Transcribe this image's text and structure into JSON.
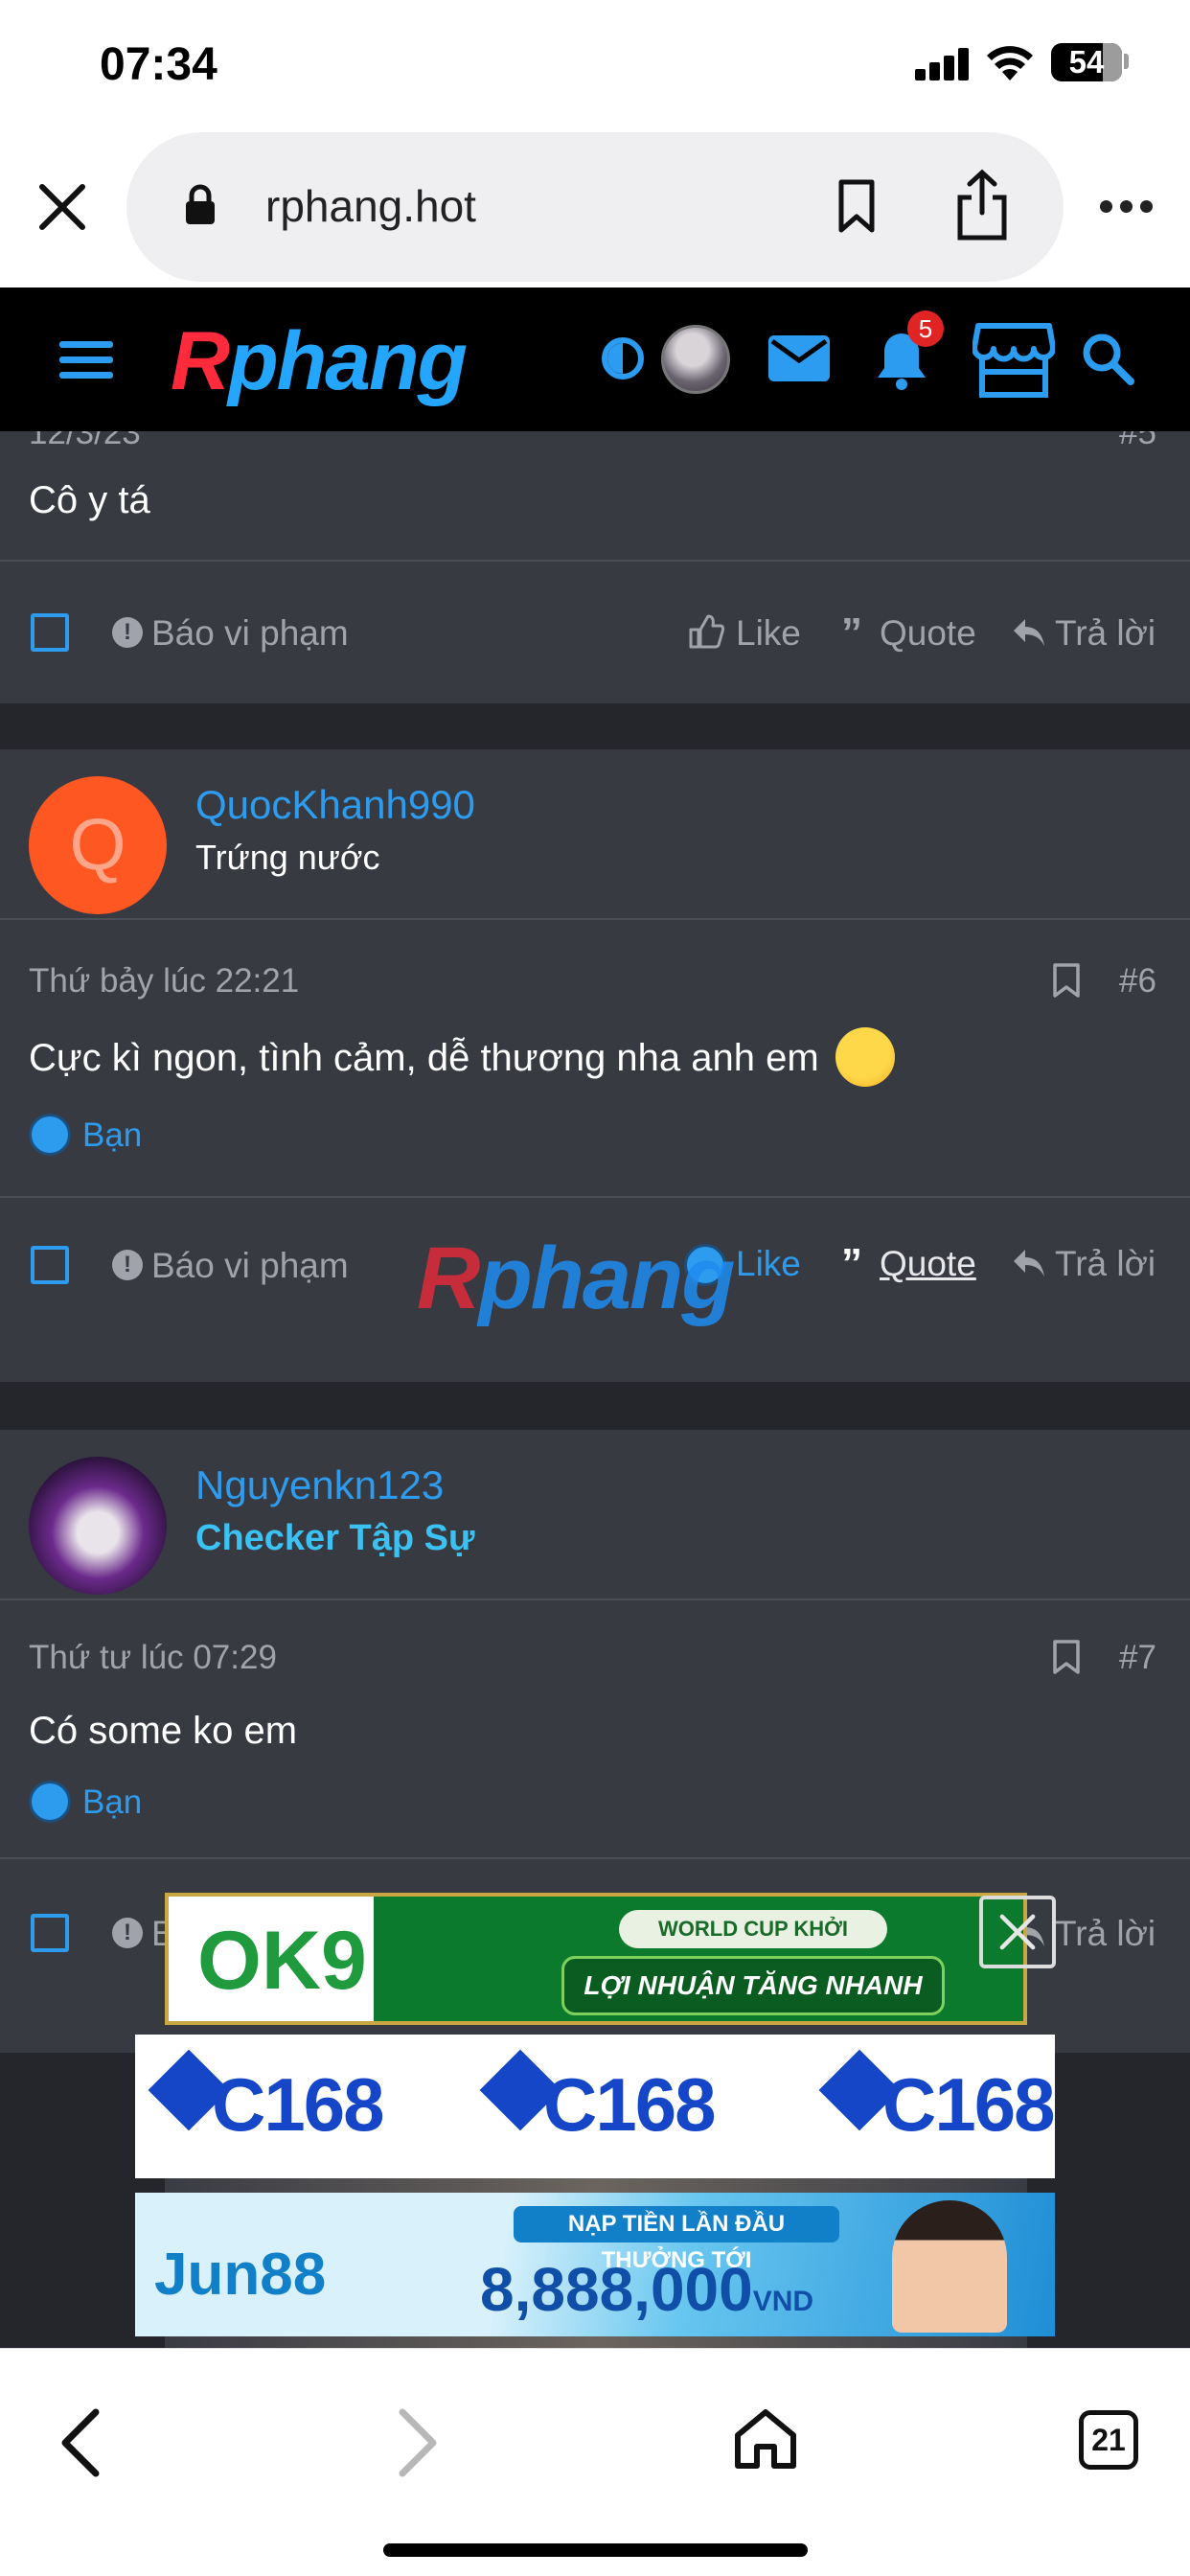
{
  "status_bar": {
    "time": "07:34",
    "battery": "54"
  },
  "browser": {
    "url": "rphang.hot",
    "tabs_count": "21"
  },
  "site_header": {
    "logo_r": "R",
    "logo_rest": "phang",
    "notification_count": "5",
    "accent_color": "#2b9cf0"
  },
  "posts": [
    {
      "date_partial": "12/3/23",
      "number": "#5",
      "message": "Cô y tá",
      "actions": {
        "report": "Báo vi phạm",
        "like": "Like",
        "quote": "Quote",
        "reply": "Trả lời"
      }
    },
    {
      "username": "QuocKhanh990",
      "avatar_letter": "Q",
      "rank": "Trứng nước",
      "date": "Thứ bảy lúc 22:21",
      "number": "#6",
      "message": "Cực kì ngon, tình cảm, dễ thương nha anh em",
      "reaction_by": "Bạn",
      "actions": {
        "report": "Báo vi phạm",
        "like": "Like",
        "quote": "Quote",
        "reply": "Trả lời"
      }
    },
    {
      "username": "Nguyenkn123",
      "rank": "Checker Tập Sự",
      "date": "Thứ tư lúc 07:29",
      "number": "#7",
      "message": "Có some ko em",
      "reaction_by": "Bạn",
      "actions": {
        "report_partial": "B",
        "reply": "Trả lời"
      }
    }
  ],
  "watermark": {
    "r": "R",
    "rest": "phang"
  },
  "ads": {
    "ok9": {
      "logo": "OK9",
      "badge": "WORLD CUP KHỞI TRANH",
      "slogan": "LỢI NHUẬN TĂNG NHANH"
    },
    "c168": {
      "label": "C168"
    },
    "jun88": {
      "logo": "Jun88",
      "top_text": "NẠP TIỀN LẦN ĐẦU THƯỞNG TỚI",
      "amount": "8,888,000",
      "currency": "VND"
    }
  }
}
